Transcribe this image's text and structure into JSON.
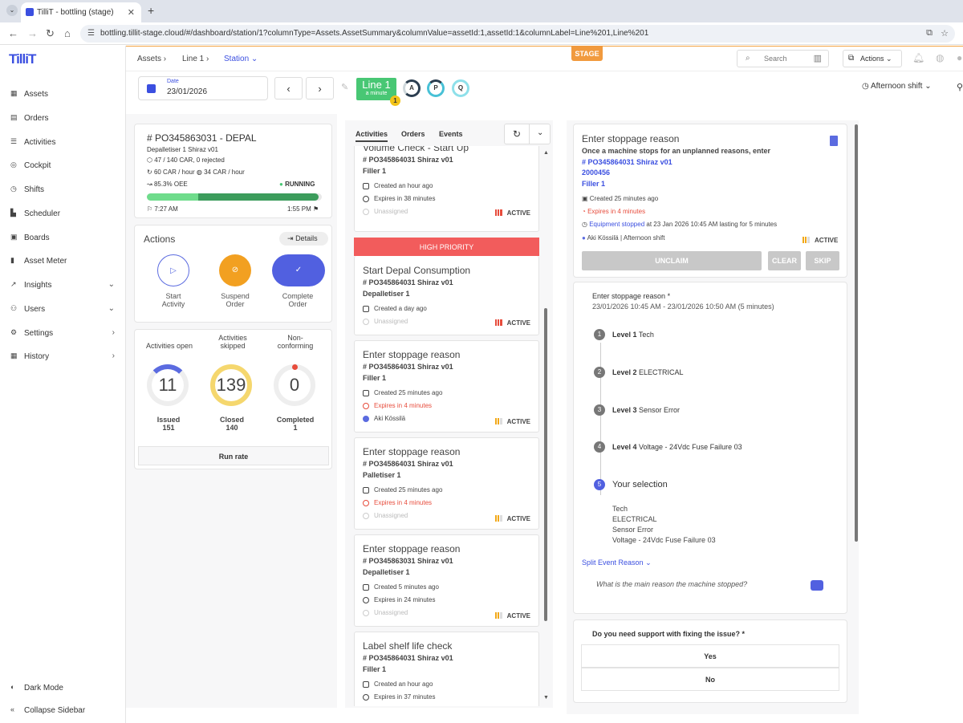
{
  "browser": {
    "tab_title": "TilliT - bottling (stage)",
    "url": "bottling.tillit-stage.cloud/#/dashboard/station/1?columnType=Assets.AssetSummary&columnValue=assetId:1,assetId:1&columnLabel=Line%201,Line%201"
  },
  "sidebar": {
    "logo": "TilliT",
    "items": [
      {
        "label": "Assets",
        "icon": "table-icon"
      },
      {
        "label": "Orders",
        "icon": "document-icon"
      },
      {
        "label": "Activities",
        "icon": "list-icon"
      },
      {
        "label": "Cockpit",
        "icon": "target-icon"
      },
      {
        "label": "Shifts",
        "icon": "clock-icon"
      },
      {
        "label": "Scheduler",
        "icon": "chart-icon"
      },
      {
        "label": "Boards",
        "icon": "grid-icon"
      },
      {
        "label": "Asset Meter",
        "icon": "phone-icon"
      },
      {
        "label": "Insights",
        "icon": "trend-icon"
      },
      {
        "label": "Users",
        "icon": "users-icon"
      },
      {
        "label": "Settings",
        "icon": "gear-icon"
      },
      {
        "label": "History",
        "icon": "calendar-icon"
      }
    ],
    "dark_mode": "Dark Mode",
    "collapse": "Collapse Sidebar"
  },
  "header": {
    "breadcrumbs": [
      "Assets",
      "Line 1",
      "Station"
    ],
    "stage": "STAGE",
    "search_placeholder": "Search",
    "actions": "Actions"
  },
  "toolbar": {
    "date_label": "Date",
    "date_value": "23/01/2026",
    "line_name": "Line 1",
    "line_sub": "a minute",
    "line_count": "1",
    "apq": [
      "A",
      "P",
      "Q"
    ],
    "shift": "Afternoon shift"
  },
  "order": {
    "title": "# PO345863031 - DEPAL",
    "product": "Depalletiser 1 Shiraz v01",
    "count": "47 / 140 CAR, 0 rejected",
    "rate1": "60 CAR / hour",
    "rate2": "34 CAR / hour",
    "oee": "85.3% OEE",
    "status": "RUNNING",
    "progress": 0.98,
    "start": "7:27 AM",
    "end": "1:55 PM"
  },
  "actions_panel": {
    "title": "Actions",
    "details": "Details",
    "buttons": [
      {
        "l1": "Start",
        "l2": "Activity"
      },
      {
        "l1": "Suspend",
        "l2": "Order"
      },
      {
        "l1": "Complete",
        "l2": "Order"
      }
    ]
  },
  "stats": {
    "headers": [
      [
        "",
        "Activities open"
      ],
      [
        "Activities",
        "skipped"
      ],
      [
        "Non-",
        "conforming"
      ]
    ],
    "values": [
      "11",
      "139",
      "0"
    ],
    "foot1": [
      "Issued",
      "Closed",
      "Completed"
    ],
    "foot2": [
      "151",
      "140",
      "1"
    ],
    "run_rate": "Run rate"
  },
  "feed": {
    "tabs": [
      "Activities",
      "Orders",
      "Events"
    ],
    "high_priority": "HIGH PRIORITY",
    "cards": [
      {
        "title": "Volume Check - Start Up",
        "po": "# PO345864031 Shiraz v01",
        "asset": "Filler 1",
        "m1": "Created an hour ago",
        "m2": "Expires in 38 minutes",
        "m3": "Unassigned",
        "status": "ACTIVE"
      },
      {
        "title": "Start Depal Consumption",
        "po": "# PO345864031 Shiraz v01",
        "asset": "Depalletiser 1",
        "m1": "Created a day ago",
        "m3": "Unassigned",
        "status": "ACTIVE"
      },
      {
        "title": "Enter stoppage reason",
        "po": "# PO345864031 Shiraz v01",
        "asset": "Filler 1",
        "m1": "Created 25 minutes ago",
        "m2": "Expires in 4 minutes",
        "m3": "Aki Kössilä",
        "status": "ACTIVE"
      },
      {
        "title": "Enter stoppage reason",
        "po": "# PO345864031 Shiraz v01",
        "asset": "Palletiser 1",
        "m1": "Created 25 minutes ago",
        "m2": "Expires in 4 minutes",
        "m3": "Unassigned",
        "status": "ACTIVE"
      },
      {
        "title": "Enter stoppage reason",
        "po": "# PO345863031 Shiraz v01",
        "asset": "Depalletiser 1",
        "m1": "Created 5 minutes ago",
        "m2": "Expires in 24 minutes",
        "m3": "Unassigned",
        "status": "ACTIVE"
      },
      {
        "title": "Label shelf life check",
        "po": "# PO345864031 Shiraz v01",
        "asset": "Filler 1",
        "m1": "Created an hour ago",
        "m2": "Expires in 37 minutes"
      }
    ]
  },
  "detail": {
    "title": "Enter stoppage reason",
    "desc": "Once a machine stops for an unplanned reasons, enter",
    "link1": "# PO345864031 Shiraz v01",
    "link2": "2000456",
    "link3": "Filler 1",
    "created": "Created 25 minutes ago",
    "expires": "Expires in 4 minutes",
    "equip_link": "Equipment stopped",
    "equip_rest": " at 23 Jan 2026 10:45 AM lasting for 5 minutes",
    "user": "Aki Kössilä | Afternoon shift",
    "status": "ACTIVE",
    "buttons": [
      "UNCLAIM",
      "CLEAR",
      "SKIP"
    ],
    "q1": "Enter stoppage reason *",
    "q1_time": "23/01/2026 10:45 AM - 23/01/2026 10:50 AM (5 minutes)",
    "levels": [
      {
        "n": "1",
        "name": "Level 1",
        "val": " Tech"
      },
      {
        "n": "2",
        "name": "Level 2",
        "val": " ELECTRICAL"
      },
      {
        "n": "3",
        "name": "Level 3",
        "val": " Sensor Error"
      },
      {
        "n": "4",
        "name": "Level 4",
        "val": " Voltage - 24Vdc Fuse Failure 03"
      }
    ],
    "sel_n": "5",
    "sel_title": "Your selection",
    "selection": [
      "Tech",
      "ELECTRICAL",
      "Sensor Error",
      "Voltage - 24Vdc Fuse Failure 03"
    ],
    "split": "Split Event Reason",
    "placeholder": "What is the main reason the machine stopped?",
    "q2": "Do you need support with fixing the issue? *",
    "yes": "Yes",
    "no": "No"
  },
  "colors": {
    "accent": "#3b4fe0",
    "running": "#48c774",
    "warn": "#f2a818",
    "danger": "#e74c3c",
    "stage": "#f19a3e"
  }
}
